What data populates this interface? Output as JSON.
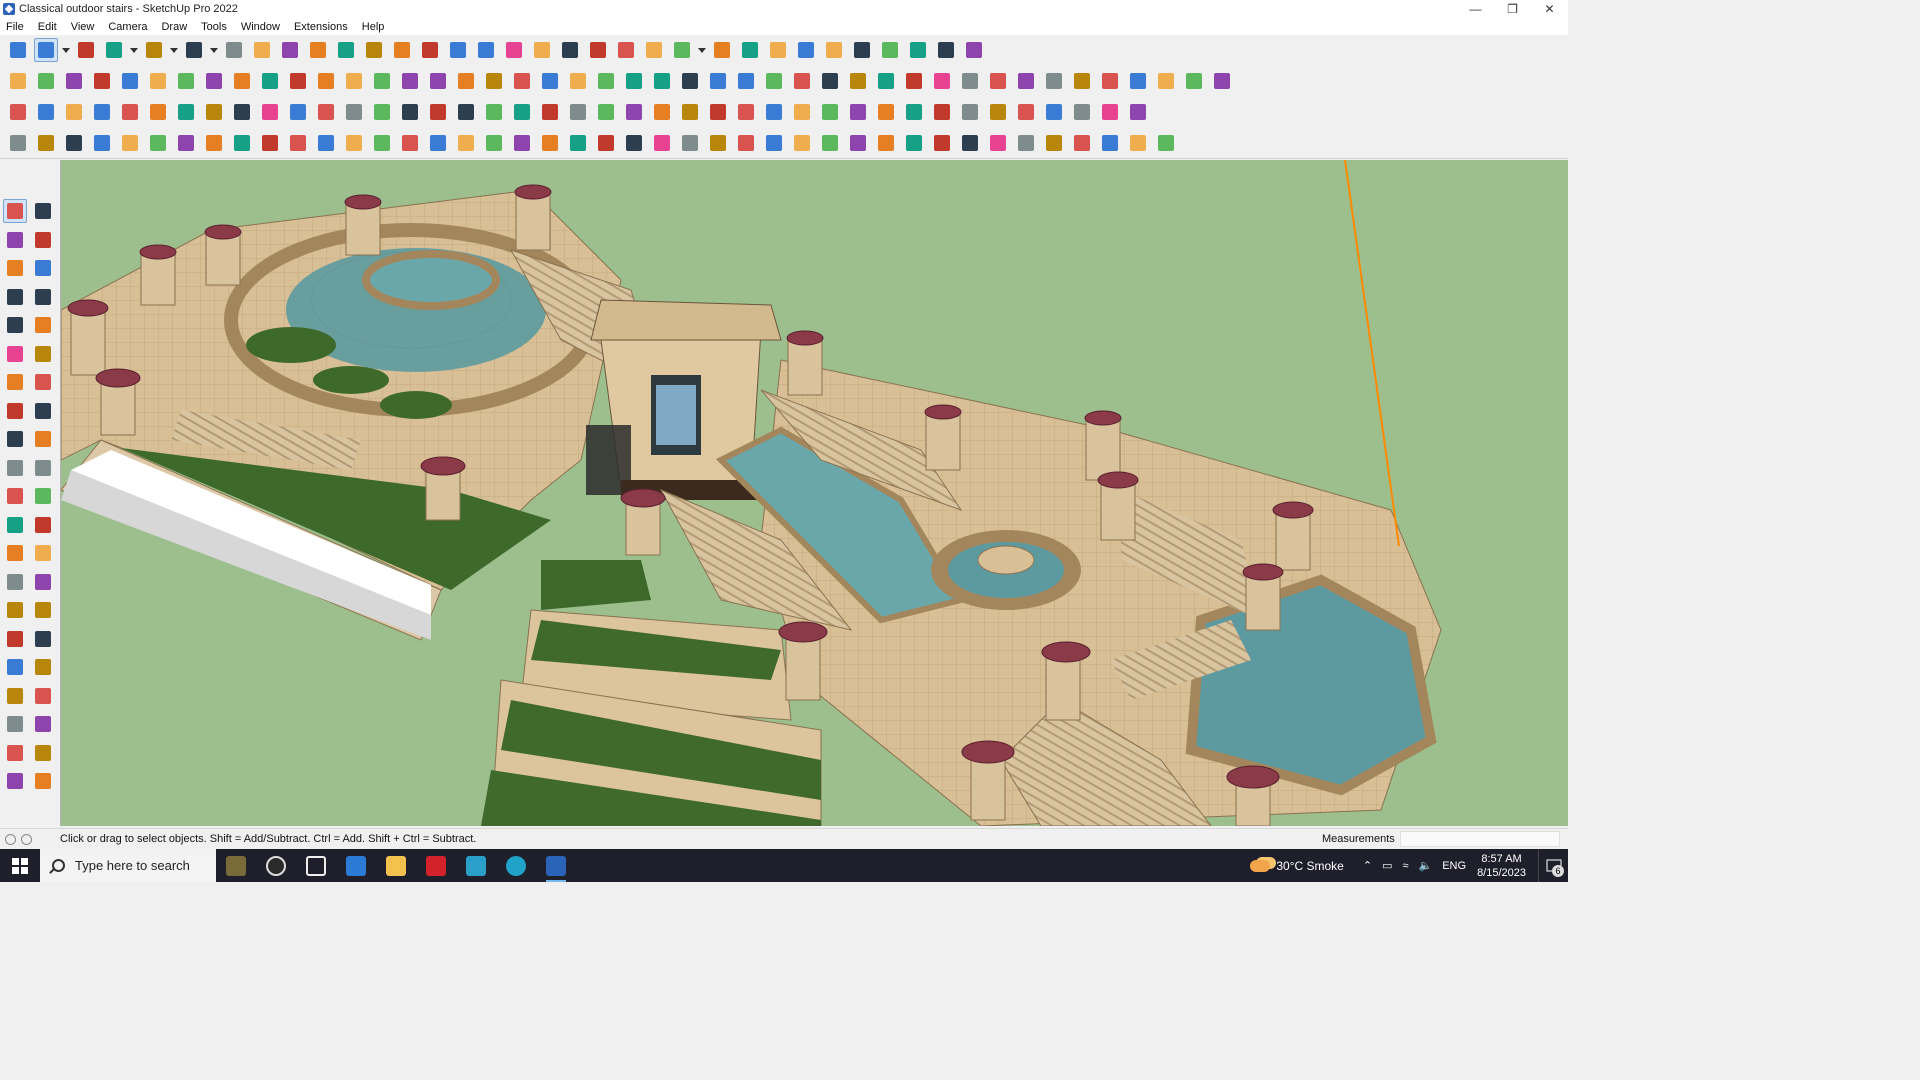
{
  "window": {
    "title": "Classical outdoor stairs - SketchUp Pro 2022",
    "controls": {
      "minimize": "—",
      "restore": "❐",
      "close": "✕"
    }
  },
  "menu": [
    "File",
    "Edit",
    "View",
    "Camera",
    "Draw",
    "Tools",
    "Window",
    "Extensions",
    "Help"
  ],
  "toolbar_icons": {
    "row1": [
      "zoom-icon",
      "select-icon",
      "dropdown-arrow-icon",
      "eraser-icon",
      "line-icon",
      "dropdown-arrow-icon",
      "arc-icon",
      "dropdown-arrow-icon",
      "rectangle-icon",
      "dropdown-arrow-icon",
      "push-pull-icon",
      "follow-me-icon",
      "move-icon",
      "rotate-icon",
      "scale-icon",
      "tape-measure-icon",
      "text-icon",
      "paint-bucket-icon",
      "orbit-icon",
      "pan-icon",
      "zoom-window-icon",
      "zoom-extents-icon",
      "sandbox-icon",
      "contours-icon",
      "layers-icon",
      "settings-icon",
      "account-icon",
      "dropdown-arrow-icon",
      "component-icon",
      "component-icon",
      "axes-icon",
      "stack-icon",
      "stack-icon",
      "resize-icon",
      "mirror-icon",
      "undo-icon",
      "redo-icon",
      "extension-icon"
    ],
    "row2": [
      "solid-icon",
      "solid-icon",
      "solid-icon",
      "intersect-icon",
      "push-icon",
      "push-icon",
      "push-icon",
      "push-icon",
      "push-icon",
      "push-icon",
      "push-icon",
      "curve-icon",
      "section-icon",
      "section-icon",
      "section-icon",
      "box-icon",
      "box-icon",
      "house-icon",
      "house-icon",
      "house-icon",
      "house-icon",
      "house-icon",
      "fx-icon",
      "tag-icon",
      "pencil-icon",
      "rectangle-icon",
      "circle-icon",
      "polygon-icon",
      "ellipse-icon",
      "parallelogram-icon",
      "arc-icon",
      "circle-icon",
      "star-icon",
      "shape-icon",
      "shape-icon",
      "arrow-icon",
      "eraser-icon",
      "texture-icon",
      "texture-icon",
      "texture-icon",
      "texture-icon",
      "texture-icon",
      "texture-icon",
      "texture-icon"
    ],
    "row3": [
      "layer-icon",
      "layer-icon",
      "layer-icon",
      "text-box-icon",
      "close-icon",
      "layer-icon",
      "layer-icon",
      "rotate-icon",
      "rectangle-icon",
      "rectangle-icon",
      "frame-icon",
      "box-icon",
      "hook-icon",
      "line-icon",
      "curve-icon",
      "cross-icon",
      "cross-icon",
      "tool-icon",
      "cone-icon",
      "cone-icon",
      "triangle-icon",
      "loop-icon",
      "loop-icon",
      "loop-icon",
      "arrows-icon",
      "bucket-icon",
      "hook-icon",
      "tool-icon",
      "tool-icon",
      "tool-icon",
      "tool-icon",
      "tool-icon",
      "tool-icon",
      "tool-icon",
      "grid-icon",
      "grid-icon",
      "grid-icon",
      "grid-icon",
      "close-icon",
      "curve-icon",
      "grid-icon"
    ],
    "row4": [
      "tool-icon",
      "tool-icon",
      "bucket-icon",
      "tool-icon",
      "tool-icon",
      "tool-icon",
      "tool-icon",
      "tool-icon",
      "tool-icon",
      "tool-icon",
      "line-icon",
      "line-icon",
      "line-icon",
      "line-icon",
      "tool-icon",
      "tool-icon",
      "tool-icon",
      "tool-icon",
      "tool-icon",
      "tool-icon",
      "tool-icon",
      "tool-icon",
      "tool-icon",
      "tool-icon",
      "tool-icon",
      "tool-icon",
      "tool-icon",
      "tool-icon",
      "tool-icon",
      "tool-icon",
      "tool-icon",
      "tool-icon",
      "tool-icon",
      "tool-icon",
      "tool-icon",
      "tool-icon",
      "tool-icon",
      "tool-icon",
      "tool-icon",
      "tool-icon",
      "tool-icon",
      "tool-icon"
    ],
    "left": [
      "select-icon",
      "orbit-icon",
      "paint-bucket-icon",
      "eraser-icon",
      "component-icon",
      "pencil-icon",
      "line-icon",
      "freehand-icon",
      "rectangle-icon",
      "rotated-rectangle-icon",
      "circle-icon",
      "polygon-icon",
      "arc-icon",
      "pie-icon",
      "arc-icon",
      "arc-icon",
      "move-icon",
      "push-pull-icon",
      "rotate-icon",
      "follow-me-icon",
      "scale-icon",
      "offset-icon",
      "tape-measure-icon",
      "dimension-icon",
      "protractor-icon",
      "text-icon",
      "axes-icon",
      "3d-text-icon",
      "orbit-icon",
      "pan-icon",
      "zoom-icon",
      "zoom-window-icon",
      "zoom-extents-icon",
      "previous-view-icon",
      "position-camera-icon",
      "look-around-icon",
      "walk-icon",
      "section-plane-icon",
      "sandbox-icon",
      "contours-icon",
      "layers-icon",
      "layers-icon"
    ]
  },
  "status": {
    "hint": "Click or drag to select objects. Shift = Add/Subtract. Ctrl = Add. Shift + Ctrl = Subtract.",
    "measurements_label": "Measurements",
    "measurements_value": ""
  },
  "taskbar": {
    "search_placeholder": "Type here to search",
    "apps": [
      "news-widget-icon",
      "cortana-icon",
      "task-view-icon",
      "calculator-icon",
      "file-explorer-icon",
      "acrobat-icon",
      "sketchup-3-icon",
      "edge-icon",
      "sketchup-icon"
    ],
    "weather": "30°C  Smoke",
    "lang": "ENG",
    "time": "8:57 AM",
    "date": "8/15/2023",
    "notifications": "6"
  },
  "colors": {
    "sky": "#9dbf8d",
    "stone": "#dcc49d",
    "grass": "#3f6a2b",
    "water": "#5d9aa0",
    "planter": "#8b3a48",
    "axis": "#ff8a00"
  }
}
